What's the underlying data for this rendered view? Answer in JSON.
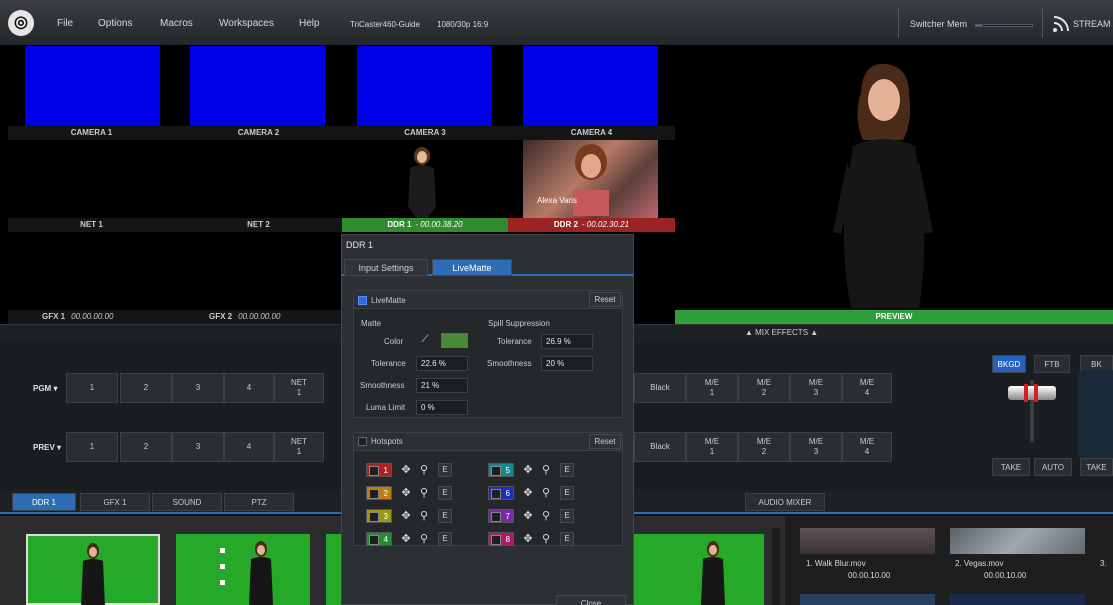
{
  "menu": {
    "items": [
      "File",
      "Options",
      "Macros",
      "Workspaces",
      "Help"
    ],
    "session": "TriCaster460-Guide",
    "format": "1080/30p 16:9",
    "switcher_mem": "Switcher Mem",
    "stream": "STREAM"
  },
  "multiview": {
    "cameras": [
      "CAMERA 1",
      "CAMERA 2",
      "CAMERA 3",
      "CAMERA 4"
    ],
    "nets": [
      "NET 1",
      "NET 2"
    ],
    "ddr1": {
      "label": "DDR 1",
      "tc": "- 00.00.38.20"
    },
    "ddr2": {
      "label": "DDR 2",
      "tc": "- 00.02.30.21",
      "caption": "Alexa Varis"
    },
    "gfx1": {
      "label": "GFX 1",
      "tc": "00.00.00.00"
    },
    "gfx2": {
      "label": "GFX 2",
      "tc": "00.00.00.00"
    },
    "preview": "PREVIEW"
  },
  "switcher": {
    "mix_effects": "▲ MIX EFFECTS ▲",
    "pgm": "PGM",
    "prev": "PREV",
    "buttons": [
      "1",
      "2",
      "3",
      "4",
      "NET\n1"
    ],
    "right_buttons": [
      "Black",
      "M/E\n1",
      "M/E\n2",
      "M/E\n3",
      "M/E\n4"
    ],
    "bkgd": "BKGD",
    "ftb": "FTB",
    "bk": "BK",
    "take": "TAKE",
    "auto": "AUTO",
    "take2": "TAKE"
  },
  "bottom_tabs": {
    "tabs": [
      "DDR 1",
      "GFX 1",
      "SOUND",
      "PTZ"
    ],
    "audio_mixer": "AUDIO MIXER"
  },
  "clips": [
    {
      "name": "1. Walk Blur.mov",
      "tc": "00.00.10.00"
    },
    {
      "name": "2. Vegas.mov",
      "tc": "00.00.10.00"
    },
    {
      "name": "3.",
      "tc": ""
    }
  ],
  "dialog": {
    "title": "DDR 1",
    "tabs": [
      "Input Settings",
      "LiveMatte"
    ],
    "livematte": {
      "label": "LiveMatte",
      "reset": "Reset",
      "matte": "Matte",
      "color": "Color",
      "color_value": "#4b8a3a",
      "tolerance_label": "Tolerance",
      "tolerance": "22.6 %",
      "smoothness_label": "Smoothness",
      "smoothness": "21 %",
      "luma_limit_label": "Luma Limit",
      "luma_limit": "0 %",
      "spill": "Spill Suppression",
      "spill_tolerance_label": "Tolerance",
      "spill_tolerance": "26.9 %",
      "spill_smoothness_label": "Smoothness",
      "spill_smoothness": "20 %"
    },
    "hotspots": {
      "label": "Hotspots",
      "reset": "Reset",
      "items": [
        {
          "n": "1",
          "color": "#b02020"
        },
        {
          "n": "2",
          "color": "#c07a10"
        },
        {
          "n": "3",
          "color": "#9a9a10"
        },
        {
          "n": "4",
          "color": "#1f8f2f"
        },
        {
          "n": "5",
          "color": "#158a8a"
        },
        {
          "n": "6",
          "color": "#1c2fb0"
        },
        {
          "n": "7",
          "color": "#7a2aa8"
        },
        {
          "n": "8",
          "color": "#a81c6a"
        }
      ],
      "edit": "E"
    },
    "close": "Close"
  }
}
